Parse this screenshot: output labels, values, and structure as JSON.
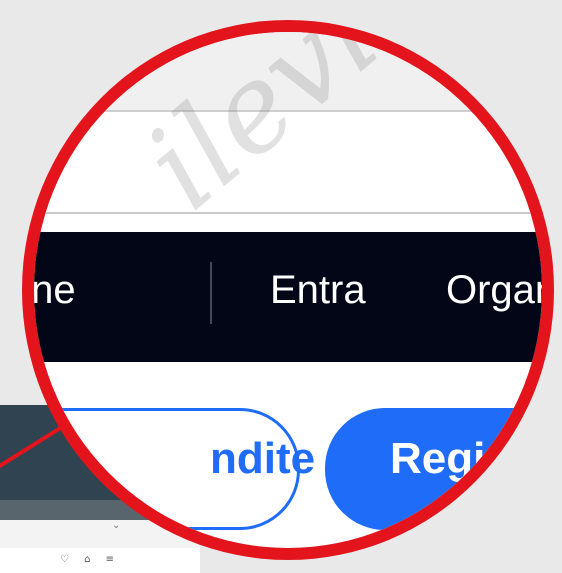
{
  "nav": {
    "item_partial_left": "ione",
    "login": "Entra",
    "organize_partial": "Organiz"
  },
  "buttons": {
    "outline_partial": "ndite",
    "register_partial": "Regist"
  },
  "watermark": "ilevito",
  "colors": {
    "callout": "#e3141c",
    "navbar": "#020617",
    "primary": "#1e6cf7"
  },
  "background_icons": "♡ ⌂ ≡"
}
